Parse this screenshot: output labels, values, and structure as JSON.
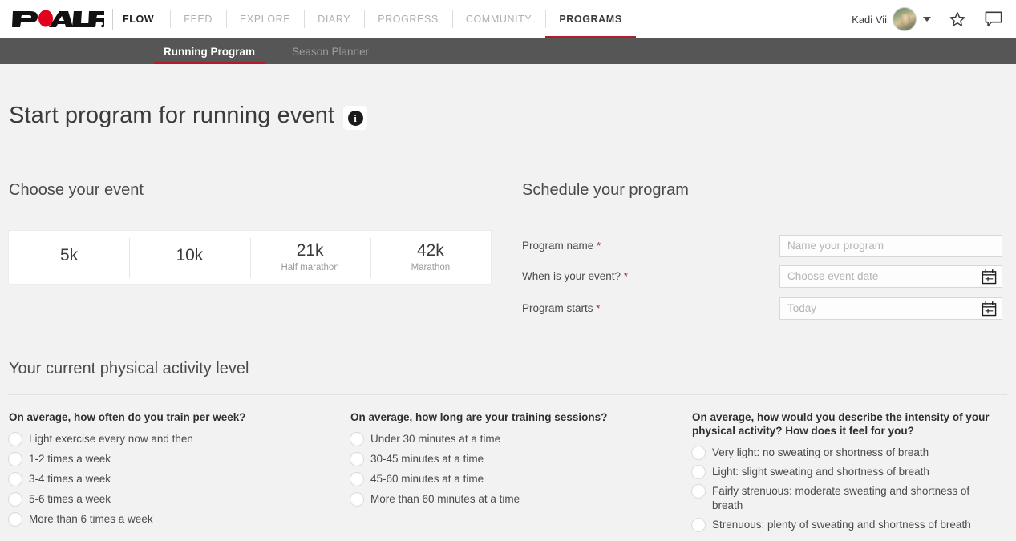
{
  "header": {
    "logo_alt": "POLAR",
    "nav": [
      {
        "label": "FLOW",
        "state": "brand"
      },
      {
        "label": "FEED",
        "state": "inactive"
      },
      {
        "label": "EXPLORE",
        "state": "inactive"
      },
      {
        "label": "DIARY",
        "state": "inactive"
      },
      {
        "label": "PROGRESS",
        "state": "inactive"
      },
      {
        "label": "COMMUNITY",
        "state": "inactive"
      },
      {
        "label": "PROGRAMS",
        "state": "active"
      }
    ],
    "user_name": "Kadi Vii",
    "icons": [
      "avatar",
      "chevron-down-icon",
      "star-icon",
      "message-icon"
    ]
  },
  "subnav": {
    "items": [
      {
        "label": "Running Program",
        "active": true
      },
      {
        "label": "Season Planner",
        "active": false
      }
    ]
  },
  "page": {
    "title": "Start program for running event",
    "info_icon_label": "i"
  },
  "event_section": {
    "heading": "Choose your event",
    "options": [
      {
        "distance": "5k",
        "subtitle": ""
      },
      {
        "distance": "10k",
        "subtitle": ""
      },
      {
        "distance": "21k",
        "subtitle": "Half marathon"
      },
      {
        "distance": "42k",
        "subtitle": "Marathon"
      }
    ]
  },
  "schedule_section": {
    "heading": "Schedule your program",
    "fields": [
      {
        "label": "Program name",
        "required": "*",
        "placeholder": "Name your program",
        "value": "",
        "calendar": false
      },
      {
        "label": "When is your event?",
        "required": "*",
        "placeholder": "Choose event date",
        "value": "",
        "calendar": true
      },
      {
        "label": "Program starts",
        "required": "*",
        "placeholder": "Today",
        "value": "",
        "calendar": true
      }
    ]
  },
  "activity_section": {
    "heading": "Your current physical activity level",
    "questions": [
      {
        "title": "On average, how often do you train per week?",
        "options": [
          "Light exercise every now and then",
          "1-2 times a week",
          "3-4 times a week",
          "5-6 times a week",
          "More than 6 times a week"
        ]
      },
      {
        "title": "On average, how long are your training sessions?",
        "options": [
          "Under 30 minutes at a time",
          "30-45 minutes at a time",
          "45-60 minutes at a time",
          "More than 60 minutes at a time"
        ]
      },
      {
        "title": "On average, how would you describe the intensity of your physical activity? How does it feel for you?",
        "options": [
          "Very light: no sweating or shortness of breath",
          "Light: slight sweating and shortness of breath",
          "Fairly strenuous: moderate sweating and shortness of breath",
          "Strenuous: plenty of sweating and shortness of breath"
        ]
      }
    ]
  },
  "colors": {
    "brand_red": "#b5192e",
    "subnav_bg": "#565656",
    "page_bg": "#f2f2f2",
    "text": "#4a4a4a"
  }
}
